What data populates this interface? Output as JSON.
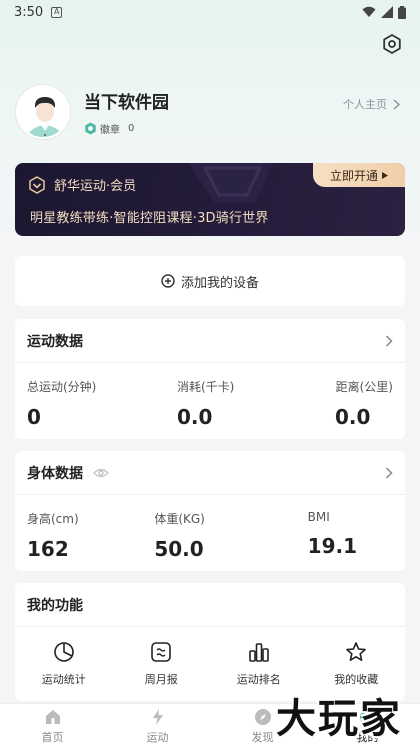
{
  "status_bar": {
    "time": "3:50",
    "notif_glyph": "A"
  },
  "profile": {
    "username": "当下软件园",
    "badge_label": "徽章",
    "badge_count": "0",
    "homepage_link": "个人主页"
  },
  "vip": {
    "title": "舒华运动·会员",
    "subtitle": "明星教练带练·智能控阻课程·3D骑行世界",
    "button": "立即开通"
  },
  "add_device": {
    "label": "添加我的设备"
  },
  "sport_data": {
    "title": "运动数据",
    "stats": [
      {
        "label": "总运动(分钟)",
        "value": "0"
      },
      {
        "label": "消耗(千卡)",
        "value": "0.0"
      },
      {
        "label": "距离(公里)",
        "value": "0.0"
      }
    ]
  },
  "body_data": {
    "title": "身体数据",
    "stats": [
      {
        "label": "身高(cm)",
        "value": "162"
      },
      {
        "label": "体重(KG)",
        "value": "50.0"
      },
      {
        "label": "BMI",
        "value": "19.1"
      }
    ]
  },
  "functions": {
    "title": "我的功能",
    "items": [
      {
        "label": "运动统计",
        "icon": "pie-chart-icon"
      },
      {
        "label": "周月报",
        "icon": "report-icon"
      },
      {
        "label": "运动排名",
        "icon": "ranking-icon"
      },
      {
        "label": "我的收藏",
        "icon": "star-icon"
      }
    ]
  },
  "tabbar": {
    "tabs": [
      {
        "label": "首页",
        "icon": "home-icon"
      },
      {
        "label": "运动",
        "icon": "lightning-icon"
      },
      {
        "label": "发现",
        "icon": "compass-icon"
      },
      {
        "label": "我的",
        "icon": "user-icon"
      }
    ],
    "active_index": 3
  },
  "watermark": "大玩家",
  "colors": {
    "vip_bg": "#1c1730",
    "vip_text": "#f2dcc0",
    "accent": "#3fb8a6"
  }
}
